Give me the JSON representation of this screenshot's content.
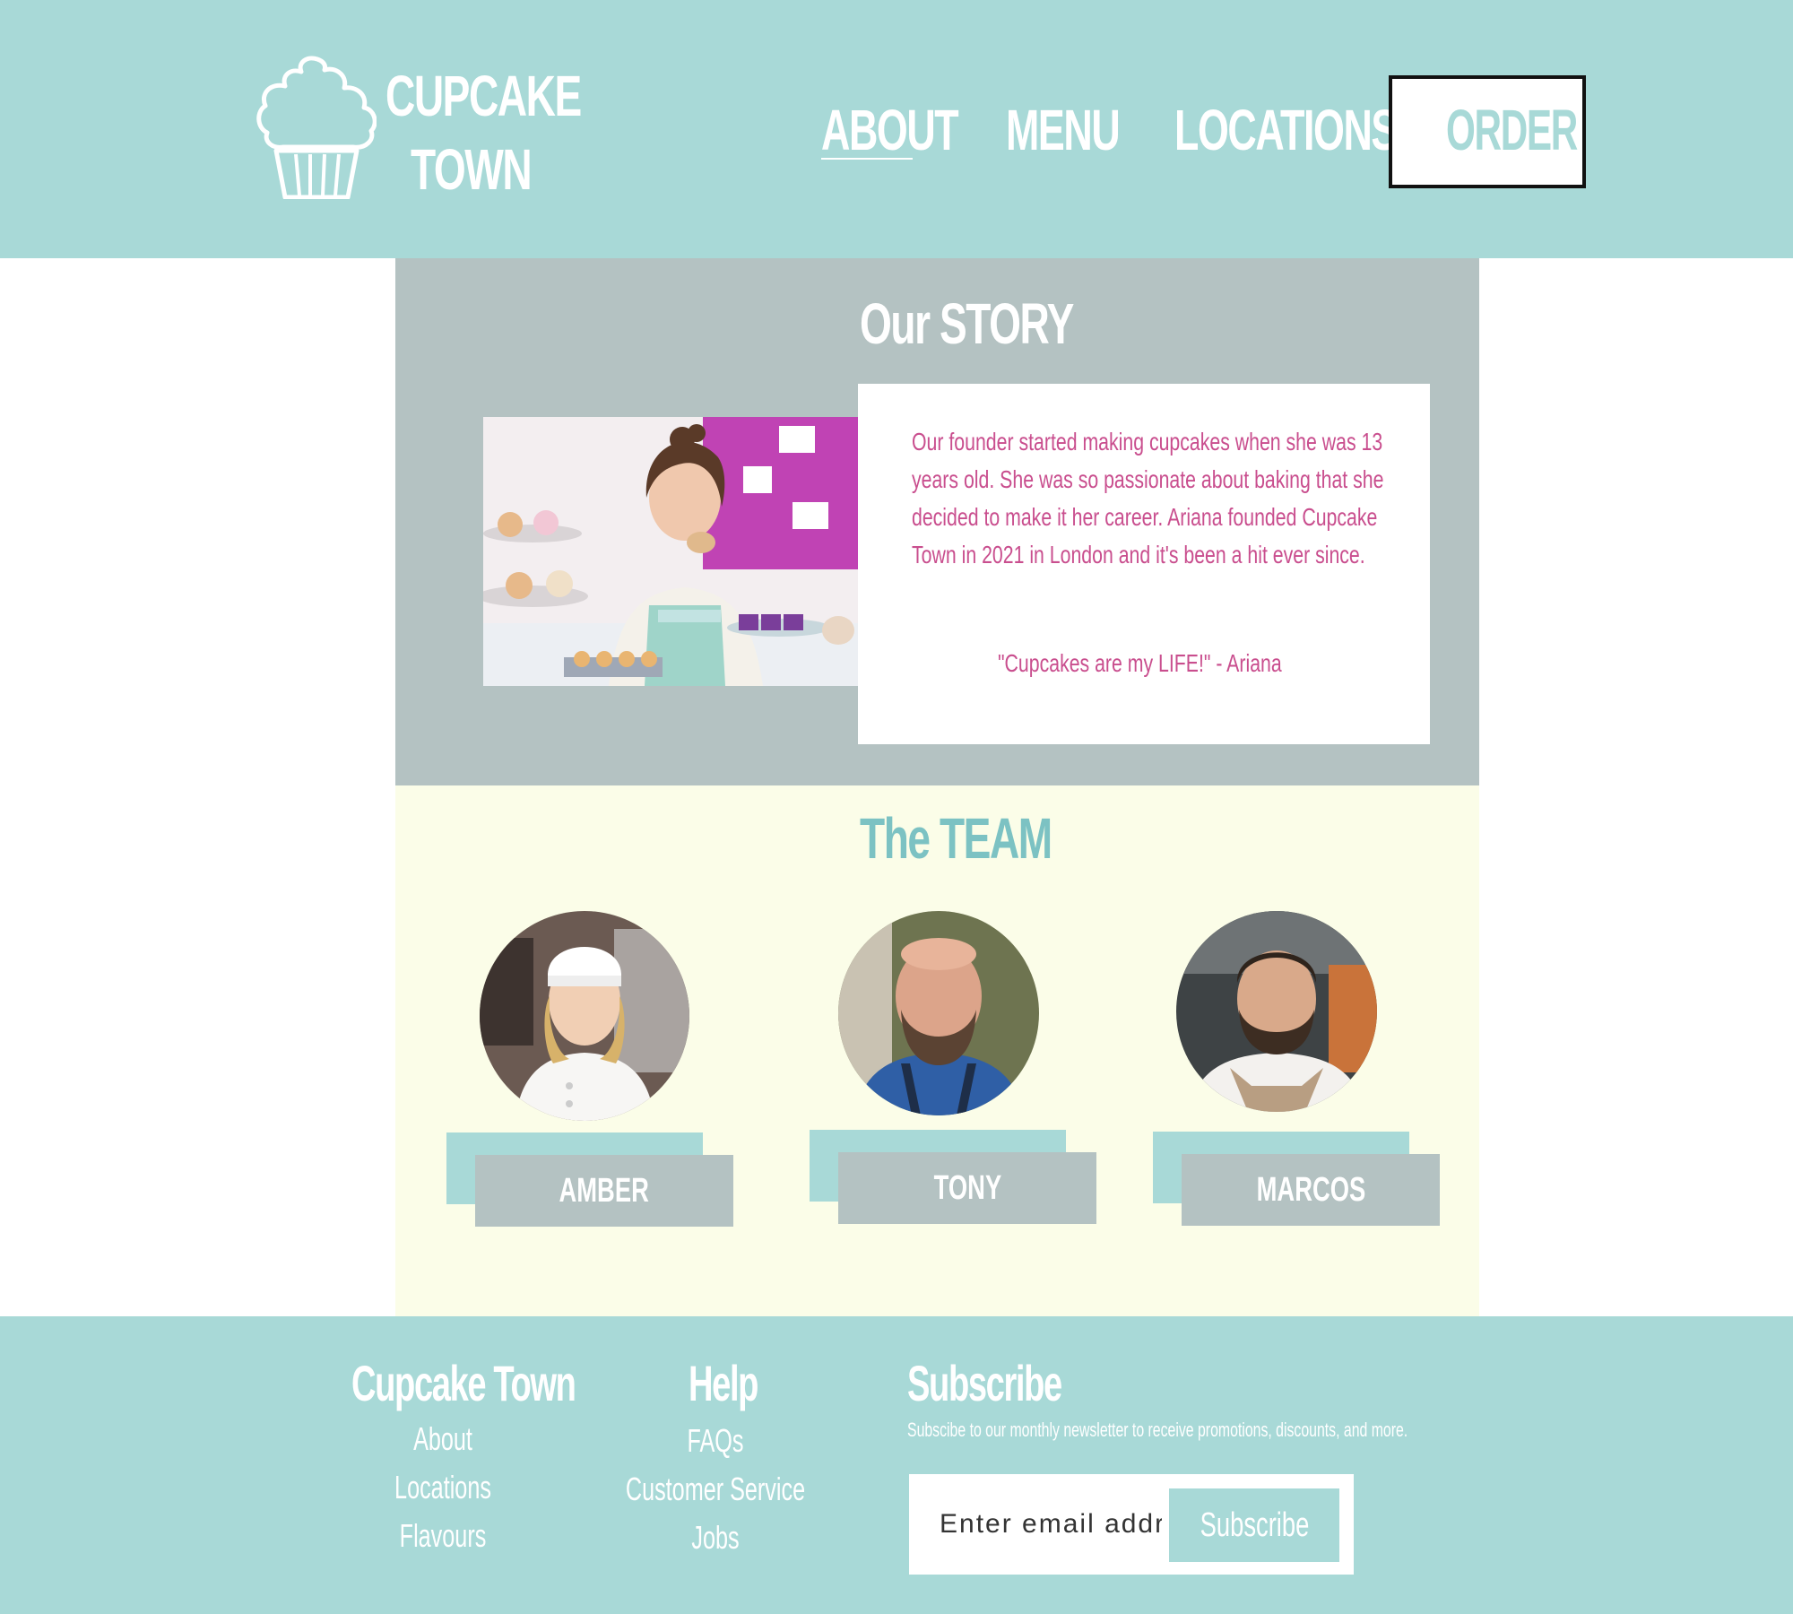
{
  "header": {
    "brand_line1": "CUPCAKE",
    "brand_line2": "TOWN",
    "nav": {
      "about": "ABOUT",
      "menu": "MENU",
      "locations": "LOCATIONS"
    },
    "order_label": "ORDER",
    "logo_icon": "cupcake-icon"
  },
  "story": {
    "title": "Our STORY",
    "text": "Our founder started making cupcakes when she was 13 years old. She was so passionate about baking that she decided to make it her career. Ariana founded Cupcake Town in 2021 in London and it's been a hit ever since.",
    "quote": "\"Cupcakes are my LIFE!\" - Ariana"
  },
  "team": {
    "title": "The TEAM",
    "members": [
      {
        "name": "AMBER"
      },
      {
        "name": "TONY"
      },
      {
        "name": "MARCOS"
      }
    ]
  },
  "footer": {
    "brand_heading": "Cupcake Town",
    "brand_links": [
      "About",
      "Locations",
      "Flavours"
    ],
    "help_heading": "Help",
    "help_links": [
      "FAQs",
      "Customer Service",
      "Jobs"
    ],
    "subscribe_heading": "Subscribe",
    "subscribe_text": "Subscibe to our monthly newsletter to receive promotions, discounts, and more.",
    "email_placeholder": "Enter email address",
    "subscribe_button": "Subscribe"
  },
  "colors": {
    "header_bg": "#a8d9d7",
    "story_bg": "#b4c2c2",
    "team_bg": "#fbfde8",
    "story_text": "#c94e8e",
    "team_title": "#7cc2c3"
  }
}
